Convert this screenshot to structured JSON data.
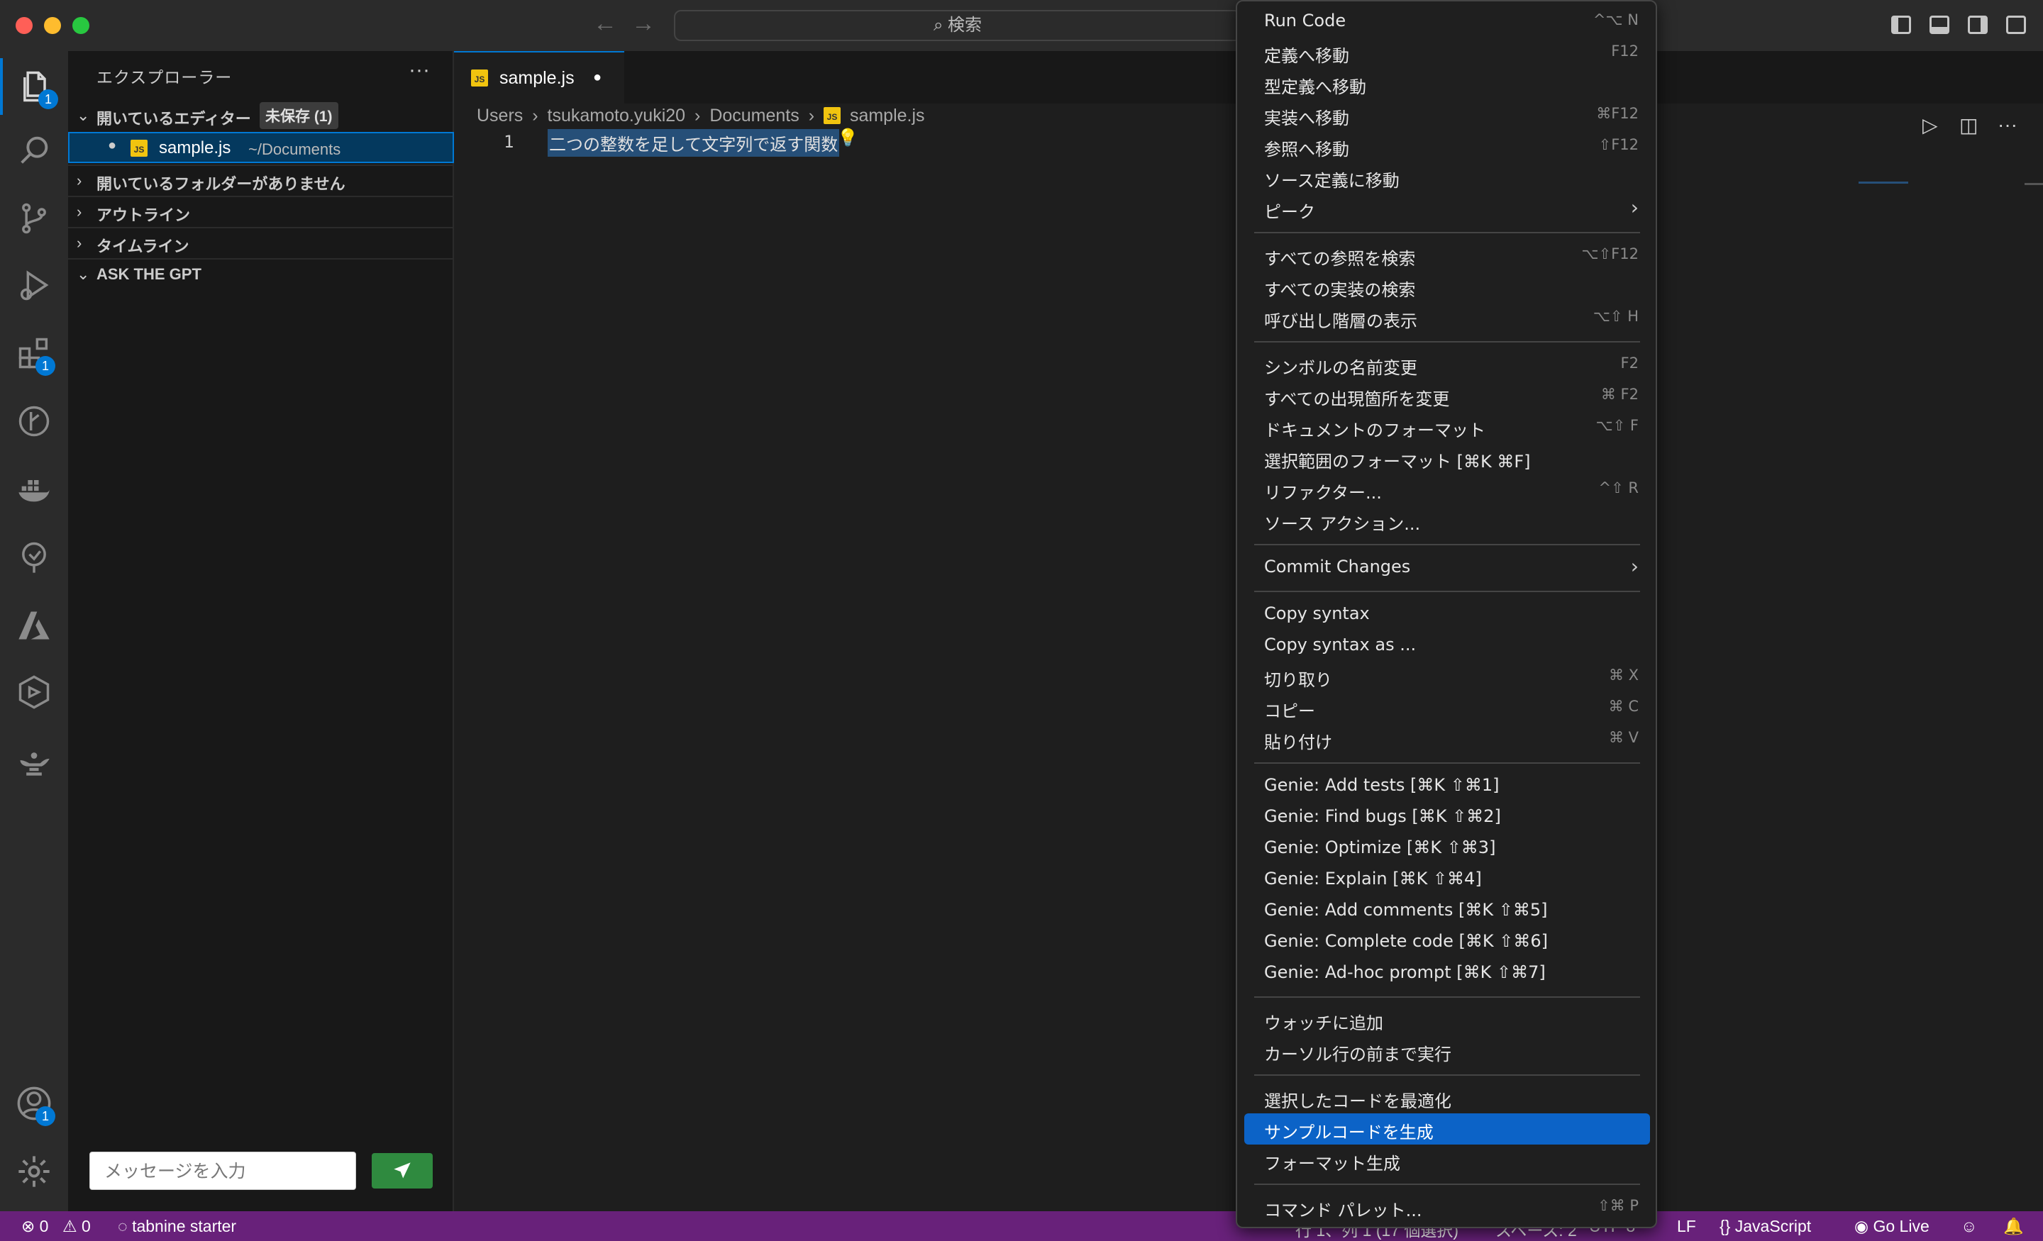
{
  "titlebar": {
    "search_text": "⌕ 検索"
  },
  "activity_bar": {
    "explorer_badge": "1",
    "extensions_badge": "1",
    "accounts_badge": "1"
  },
  "sidebar": {
    "title": "エクスプローラー",
    "more": "···",
    "open_editors": {
      "label": "開いているエディター",
      "unsaved": "未保存 (1)"
    },
    "file": {
      "name": "sample.js",
      "path": "~/Documents",
      "icon_text": "JS"
    },
    "no_folder": "開いているフォルダーがありません",
    "outline": "アウトライン",
    "timeline": "タイムライン",
    "ask_gpt": "ASK THE GPT",
    "message_placeholder": "メッセージを入力"
  },
  "editor": {
    "tab": {
      "name": "sample.js",
      "dot": "●"
    },
    "breadcrumb": [
      "Users",
      "tsukamoto.yuki20",
      "Documents",
      "sample.js"
    ],
    "line_number": "1",
    "code_line": "二つの整数を足して文字列で返す関数"
  },
  "context_menu": {
    "groups": [
      [
        {
          "label": "Run Code",
          "key": "^⌥ N"
        },
        {
          "label": "定義へ移動",
          "key": "F12"
        },
        {
          "label": "型定義へ移動",
          "key": ""
        },
        {
          "label": "実装へ移動",
          "key": "⌘F12"
        },
        {
          "label": "参照へ移動",
          "key": "⇧F12"
        },
        {
          "label": "ソース定義に移動",
          "key": ""
        },
        {
          "label": "ピーク",
          "key": "",
          "submenu": true
        }
      ],
      [
        {
          "label": "すべての参照を検索",
          "key": "⌥⇧F12"
        },
        {
          "label": "すべての実装の検索",
          "key": ""
        },
        {
          "label": "呼び出し階層の表示",
          "key": "⌥⇧ H"
        }
      ],
      [
        {
          "label": "シンボルの名前変更",
          "key": "F2"
        },
        {
          "label": "すべての出現箇所を変更",
          "key": "⌘ F2"
        },
        {
          "label": "ドキュメントのフォーマット",
          "key": "⌥⇧ F"
        },
        {
          "label": "選択範囲のフォーマット [⌘K ⌘F]",
          "key": ""
        },
        {
          "label": "リファクター...",
          "key": "^⇧ R"
        },
        {
          "label": "ソース アクション...",
          "key": ""
        }
      ],
      [
        {
          "label": "Commit Changes",
          "key": "",
          "submenu": true
        }
      ],
      [
        {
          "label": "Copy syntax",
          "key": ""
        },
        {
          "label": "Copy syntax as ...",
          "key": ""
        },
        {
          "label": "切り取り",
          "key": "⌘ X"
        },
        {
          "label": "コピー",
          "key": "⌘ C"
        },
        {
          "label": "貼り付け",
          "key": "⌘ V"
        }
      ],
      [
        {
          "label": "Genie: Add tests [⌘K ⇧⌘1]",
          "key": ""
        },
        {
          "label": "Genie: Find bugs [⌘K ⇧⌘2]",
          "key": ""
        },
        {
          "label": "Genie: Optimize [⌘K ⇧⌘3]",
          "key": ""
        },
        {
          "label": "Genie: Explain [⌘K ⇧⌘4]",
          "key": ""
        },
        {
          "label": "Genie: Add comments [⌘K ⇧⌘5]",
          "key": ""
        },
        {
          "label": "Genie: Complete code [⌘K ⇧⌘6]",
          "key": ""
        },
        {
          "label": "Genie: Ad-hoc prompt [⌘K ⇧⌘7]",
          "key": ""
        }
      ],
      [
        {
          "label": "ウォッチに追加",
          "key": ""
        },
        {
          "label": "カーソル行の前まで実行",
          "key": ""
        }
      ],
      [
        {
          "label": "選択したコードを最適化",
          "key": ""
        },
        {
          "label": "サンプルコードを生成",
          "key": "",
          "selected": true
        },
        {
          "label": "フォーマット生成",
          "key": ""
        }
      ],
      [
        {
          "label": "コマンド パレット...",
          "key": "⇧⌘ P"
        }
      ]
    ]
  },
  "statusbar": {
    "errors": "⊗ 0",
    "warnings": "⚠ 0",
    "tabnine": "tabnine starter",
    "position": "行 1、列 1 (17 個選択)",
    "spaces": "スペース: 2",
    "encoding": "UTF-8",
    "eol": "LF",
    "language": "JavaScript",
    "golive": "Go Live"
  }
}
